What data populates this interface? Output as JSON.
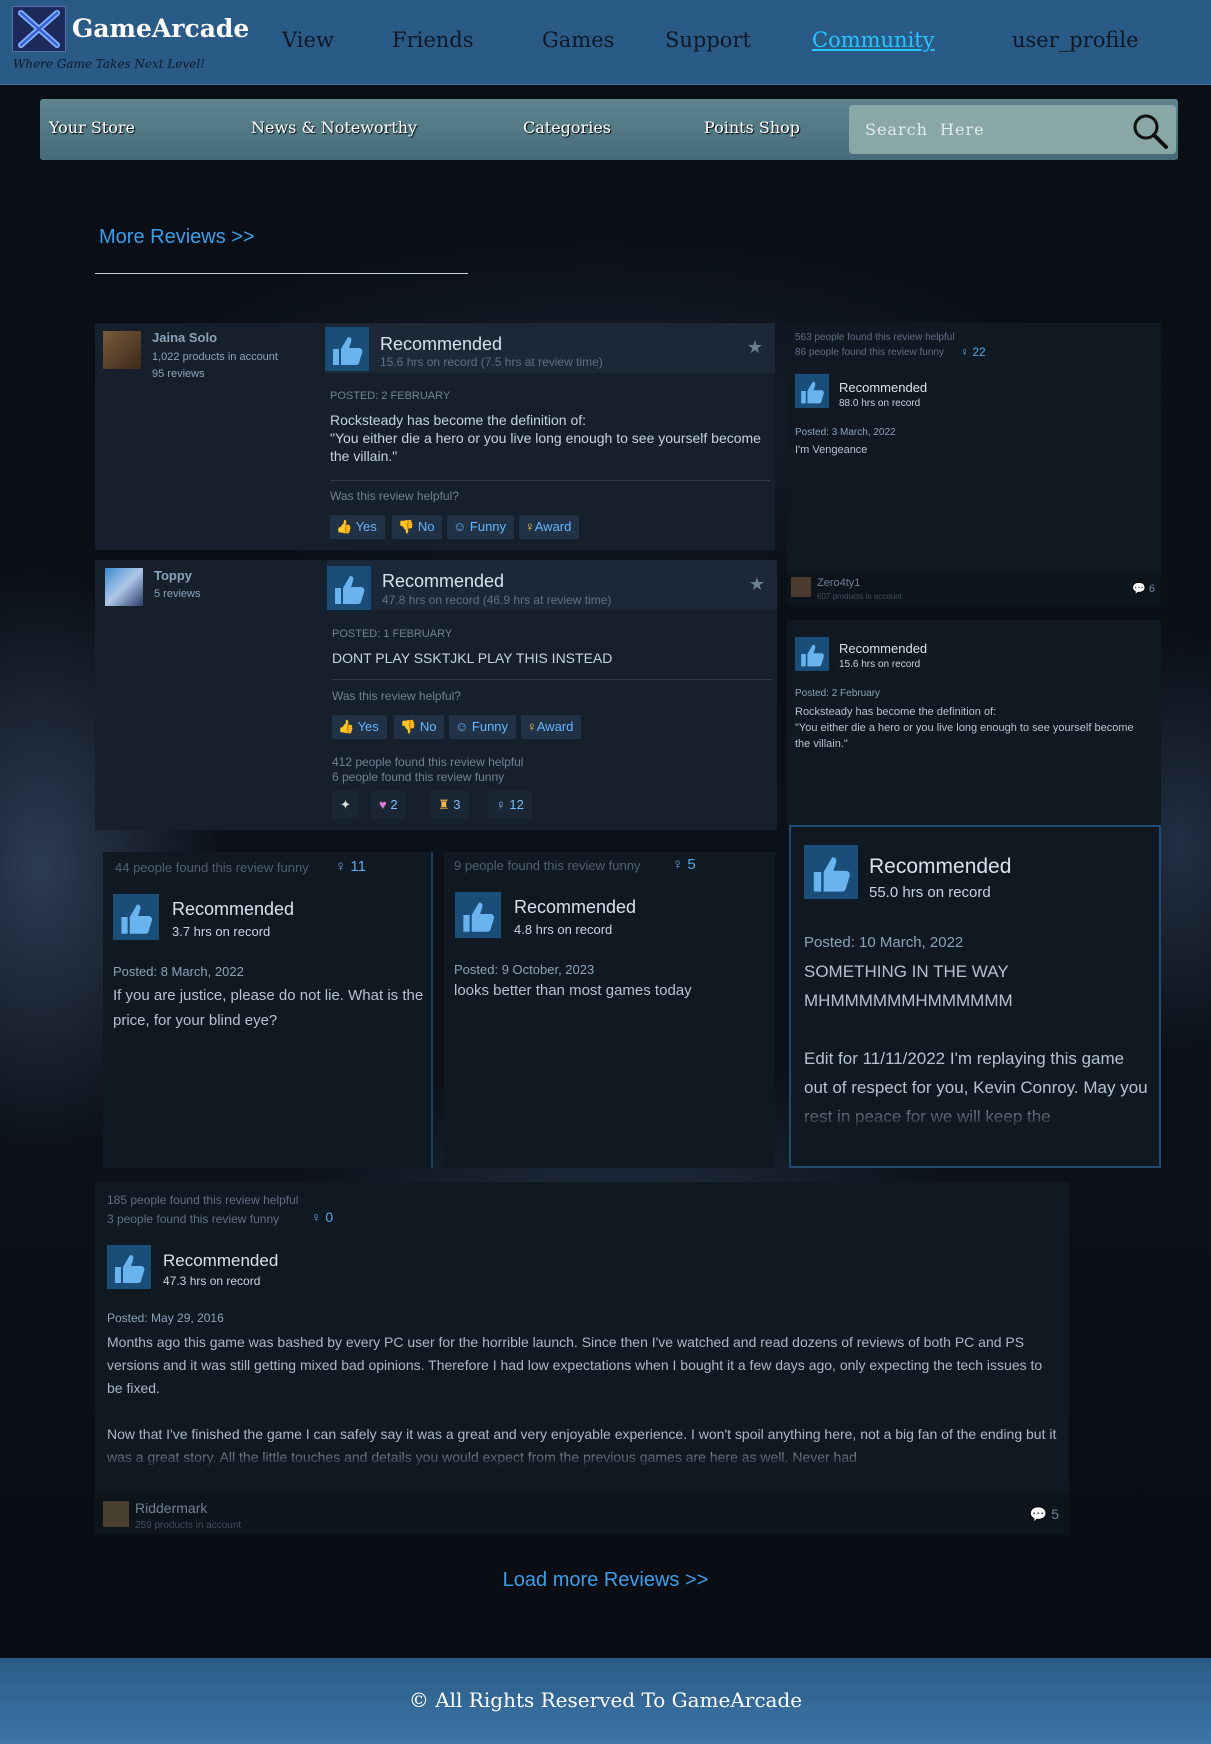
{
  "brand": {
    "name": "GameArcade",
    "tagline": "Where Game Takes Next Level!"
  },
  "nav": [
    "View",
    "Friends",
    "Games",
    "Support",
    "Community",
    "user_profile"
  ],
  "subnav": [
    "Your Store",
    "News & Noteworthy",
    "Categories",
    "Points Shop"
  ],
  "search": {
    "placeholder": "Search  Here"
  },
  "more_reviews": "More Reviews >>",
  "load_more": "Load more Reviews >>",
  "footer": "© All Rights Reserved To GameArcade",
  "review1": {
    "user": "Jaina Solo",
    "products": "1,022 products in account",
    "reviews": "95 reviews",
    "title": "Recommended",
    "hours": "15.6 hrs on record (7.5 hrs at review time)",
    "posted": "POSTED: 2 FEBRUARY",
    "text1": "Rocksteady has become the definition of:",
    "text2": "\"You either die a hero or you live long enough to see yourself become the villain.\"",
    "helpful_q": "Was this review helpful?",
    "yes": "Yes",
    "no": "No",
    "funny": "Funny",
    "award": "Award"
  },
  "review2": {
    "user": "Toppy",
    "reviews": "5 reviews",
    "title": "Recommended",
    "hours": "47.8 hrs on record (46.9 hrs at review time)",
    "posted": "POSTED: 1 FEBRUARY",
    "text": "DONT PLAY SSKTJKL PLAY THIS INSTEAD",
    "helpful_q": "Was this review helpful?",
    "yes": "Yes",
    "no": "No",
    "funny": "Funny",
    "award": "Award",
    "helpful_count": "412 people found this review helpful",
    "funny_count": "6 people found this review funny",
    "awards": [
      "2",
      "3",
      "12"
    ]
  },
  "review_side1": {
    "helpful": "563 people found this review helpful",
    "funny": "86 people found this review funny",
    "award_count": "22",
    "title": "Recommended",
    "hours": "88.0 hrs on record",
    "posted": "Posted: 3 March, 2022",
    "text": "I'm Vengeance",
    "user": "Zero4ty1",
    "products": "607 products in account",
    "comments": "6"
  },
  "review_side2": {
    "title": "Recommended",
    "hours": "15.6 hrs on record",
    "posted": "Posted: 2 February",
    "text1": "Rocksteady has become the definition of:",
    "text2": "\"You either die a hero or you live long enough to see yourself become the villain.\""
  },
  "review3": {
    "funny": "44 people found this review funny",
    "award_count": "11",
    "title": "Recommended",
    "hours": "3.7 hrs on record",
    "posted": "Posted: 8 March, 2022",
    "text": "If you are justice, please do not lie. What is the price, for your blind eye?"
  },
  "review4": {
    "funny": "9 people found this review funny",
    "award_count": "5",
    "title": "Recommended",
    "hours": "4.8 hrs on record",
    "posted": "Posted: 9 October, 2023",
    "text": "looks better than most games today"
  },
  "review5": {
    "title": "Recommended",
    "hours": "55.0 hrs on record",
    "posted": "Posted: 10 March, 2022",
    "text1": "SOMETHING IN THE WAY MHMMMMMMHMMMMMM",
    "text2": "Edit for 11/11/2022 I'm replaying this game out of respect for you, Kevin Conroy. May you rest in peace for we will keep the"
  },
  "review6": {
    "helpful": "185 people found this review helpful",
    "funny": "3 people found this review funny",
    "award_count": "0",
    "title": "Recommended",
    "hours": "47.3 hrs on record",
    "posted": "Posted: May 29, 2016",
    "text1": "Months ago this game was bashed by every PC user for the horrible launch. Since then I've watched and read dozens of reviews of both PC and PS versions and it was still getting mixed bad opinions. Therefore I had low expectations when I bought it a few days ago, only expecting the tech issues to be fixed.",
    "text2": "Now that I've finished the game I can safely say it was a great and very enjoyable experience. I won't spoil anything here, not a big fan of the ending but it was a great story. All the little touches and details you would expect from the previous games are here as well. Never had",
    "user": "Riddermark",
    "products": "259 products in account",
    "comments": "5"
  }
}
